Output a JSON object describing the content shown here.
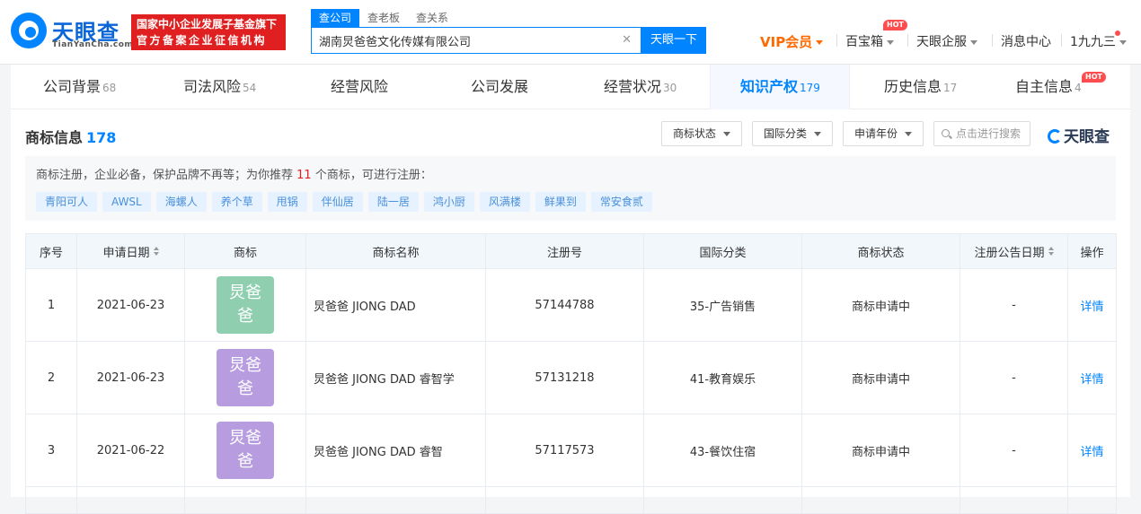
{
  "header": {
    "logo_name": "天眼查",
    "logo_domain": "TianYanCha.com",
    "promo_line1": "国家中小企业发展子基金旗下",
    "promo_line2": "官方备案企业征信机构",
    "search_tabs": [
      "查公司",
      "查老板",
      "查关系"
    ],
    "search_value": "湖南炅爸爸文化传媒有限公司",
    "search_button": "天眼一下",
    "nav": {
      "vip": "VIP会员",
      "treasure": "百宝箱",
      "treasure_badge": "HOT",
      "enterprise": "天眼企服",
      "messages": "消息中心",
      "user": "1九九三"
    }
  },
  "tabs": [
    {
      "label": "公司背景",
      "count": "68"
    },
    {
      "label": "司法风险",
      "count": "54"
    },
    {
      "label": "经营风险",
      "count": ""
    },
    {
      "label": "公司发展",
      "count": ""
    },
    {
      "label": "经营状况",
      "count": "30"
    },
    {
      "label": "知识产权",
      "count": "179"
    },
    {
      "label": "历史信息",
      "count": "17"
    },
    {
      "label": "自主信息",
      "count": "4",
      "badge": "HOT"
    }
  ],
  "section": {
    "title": "商标信息",
    "total": "178",
    "filters": [
      "商标状态",
      "国际分类",
      "申请年份"
    ],
    "search_placeholder": "点击进行搜索",
    "brand": "天眼查"
  },
  "recommend": {
    "text_before": "商标注册，企业必备，保护品牌不再等；为你推荐 ",
    "count": "11",
    "text_after": " 个商标，可进行注册：",
    "chips": [
      "青阳可人",
      "AWSL",
      "海螺人",
      "养个草",
      "甩锅",
      "伴仙居",
      "陆一居",
      "鸿小厨",
      "风满楼",
      "鲜果到",
      "常安食贰"
    ]
  },
  "table": {
    "headers": [
      "序号",
      "申请日期",
      "商标",
      "商标名称",
      "注册号",
      "国际分类",
      "商标状态",
      "注册公告日期",
      "操作"
    ],
    "rows": [
      {
        "no": "1",
        "date": "2021-06-23",
        "mark": "炅爸爸",
        "mark_color": "#8fcfb0",
        "name": "炅爸爸 JIONG DAD",
        "reg": "57144788",
        "class": "35-广告销售",
        "status": "商标申请中",
        "notice": "-",
        "action": "详情"
      },
      {
        "no": "2",
        "date": "2021-06-23",
        "mark": "炅爸爸",
        "mark_color": "#b79de0",
        "name": "炅爸爸 JIONG DAD 睿智学",
        "reg": "57131218",
        "class": "41-教育娱乐",
        "status": "商标申请中",
        "notice": "-",
        "action": "详情"
      },
      {
        "no": "3",
        "date": "2021-06-22",
        "mark": "炅爸爸",
        "mark_color": "#b79de0",
        "name": "炅爸爸 JIONG DAD 睿智",
        "reg": "57117573",
        "class": "43-餐饮住宿",
        "status": "商标申请中",
        "notice": "-",
        "action": "详情"
      }
    ]
  },
  "colors": {
    "accent": "#0084ff",
    "promo": "#e02020",
    "vip": "#ff6a00",
    "hot": "#ff4d4f"
  }
}
